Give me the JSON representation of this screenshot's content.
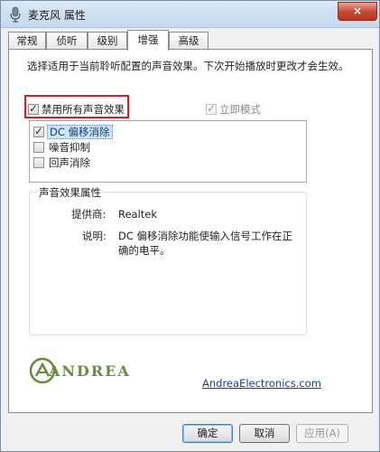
{
  "window": {
    "title": "麦克风 属性",
    "close_glyph": "×"
  },
  "tabs": [
    {
      "label": "常规"
    },
    {
      "label": "侦听"
    },
    {
      "label": "级别"
    },
    {
      "label": "增强"
    },
    {
      "label": "高级"
    }
  ],
  "description": "选择适用于当前聆听配置的声音效果。下次开始播放时更改才会生效。",
  "disable_all": {
    "label": "禁用所有声音效果",
    "checked": true
  },
  "instant_mode": {
    "label": "立即模式",
    "checked": true,
    "enabled": false
  },
  "effects": [
    {
      "label": "DC 偏移消除",
      "checked": true,
      "selected": true
    },
    {
      "label": "噪音抑制",
      "checked": false,
      "selected": false
    },
    {
      "label": "回声消除",
      "checked": false,
      "selected": false
    }
  ],
  "properties": {
    "title": "声音效果属性",
    "provider_label": "提供商:",
    "provider_value": "Realtek",
    "description_label": "说明:",
    "description_value": "DC 偏移消除功能使输入信号工作在正确的电平。"
  },
  "brand": {
    "logo_text": "ANDREA",
    "link_text": "AndreaElectronics.com",
    "color": "#6b8b3c"
  },
  "buttons": {
    "ok": "确定",
    "cancel": "取消",
    "apply": "应用(A)"
  }
}
